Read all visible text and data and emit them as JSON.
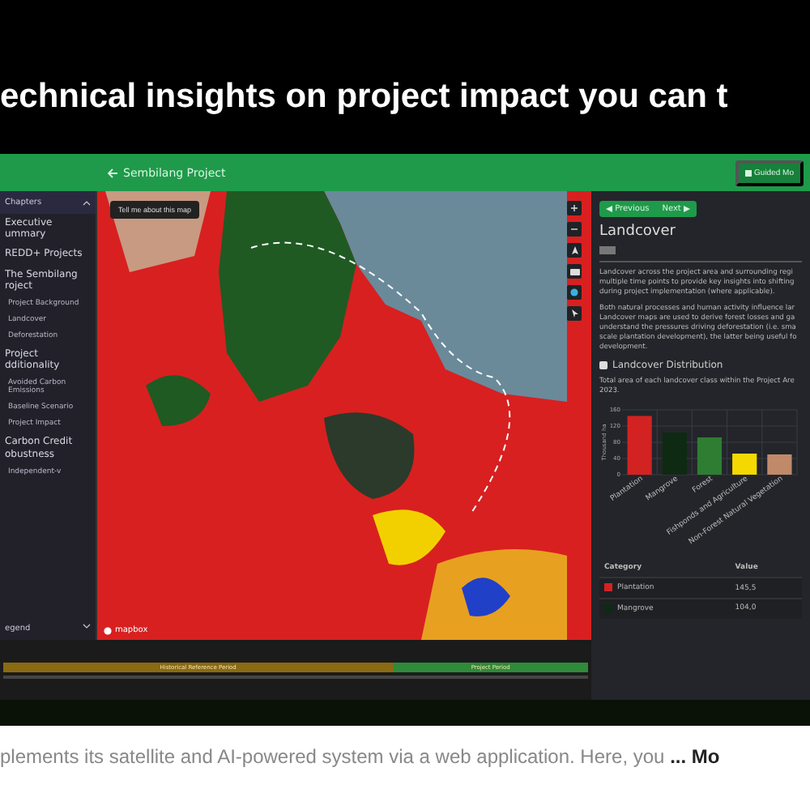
{
  "heading": "echnical insights on project impact you can t",
  "header": {
    "back_label": "Sembilang Project",
    "guided_button": "Guided Mo"
  },
  "sidebar": {
    "title": "Chapters",
    "legend": "egend",
    "items": [
      {
        "label": "Executive ummary"
      },
      {
        "label": "REDD+ Projects"
      },
      {
        "label": "The Sembilang roject",
        "children": [
          {
            "label": "Project Background"
          },
          {
            "label": "Landcover"
          },
          {
            "label": "Deforestation"
          }
        ]
      },
      {
        "label": "Project dditionality",
        "children": [
          {
            "label": "Avoided Carbon Emissions"
          },
          {
            "label": "Baseline Scenario"
          },
          {
            "label": "Project Impact"
          }
        ]
      },
      {
        "label": "Carbon Credit obustness",
        "children": [
          {
            "label": "Independent-v"
          }
        ]
      }
    ]
  },
  "map": {
    "info_button": "Tell me about this map",
    "attribution": "mapbox"
  },
  "timeline": {
    "periods": [
      {
        "label": "Historical Reference Period",
        "kind": "historical"
      },
      {
        "label": "Project Period",
        "kind": "project"
      }
    ]
  },
  "panel": {
    "previous": "Previous",
    "next": "Next",
    "title": "Landcover",
    "paragraphs": [
      "Landcover across the project area and surrounding regi multiple time points to provide key insights into shifting during project implementation (where applicable).",
      "Both natural processes and human activity influence lar Landcover maps are used to derive forest losses and ga understand the pressures driving deforestation (i.e. sma scale plantation development), the latter being useful fo development."
    ],
    "distribution_checked": false,
    "distribution_title": "Landcover Distribution",
    "description": "Total area of each landcover class within the Project Are 2023.",
    "chart_data": {
      "type": "bar",
      "ylabel": "Thousand ha",
      "categories": [
        "Plantation",
        "Mangrove",
        "Forest",
        "Fishponds and Agriculture",
        "Non-Forest Natural Vegetation"
      ],
      "ylim": [
        0,
        160
      ],
      "yticks": [
        0,
        40,
        80,
        120,
        160
      ],
      "stacked": true,
      "grid": true,
      "series": [
        {
          "color": "#d32222",
          "values": [
            145,
            null,
            null,
            null,
            null
          ]
        },
        {
          "color": "#0f2a12",
          "values": [
            null,
            104,
            null,
            null,
            null
          ]
        },
        {
          "color": "#2e7d32",
          "values": [
            null,
            null,
            92,
            null,
            null
          ]
        },
        {
          "color": "#f5d800",
          "values": [
            null,
            null,
            null,
            52,
            null
          ]
        },
        {
          "color": "#c08a6a",
          "values": [
            null,
            null,
            null,
            null,
            50
          ]
        }
      ]
    },
    "table": {
      "columns": [
        "Category",
        "Value"
      ],
      "rows": [
        {
          "category": "Plantation",
          "value": "145,5",
          "color": "#d32222"
        },
        {
          "category": "Mangrove",
          "value": "104,0",
          "color": "#0f2a12"
        }
      ]
    }
  },
  "caption": {
    "text": "plements its satellite and AI-powered system via a web application. Here, you",
    "more": "... Mo"
  }
}
